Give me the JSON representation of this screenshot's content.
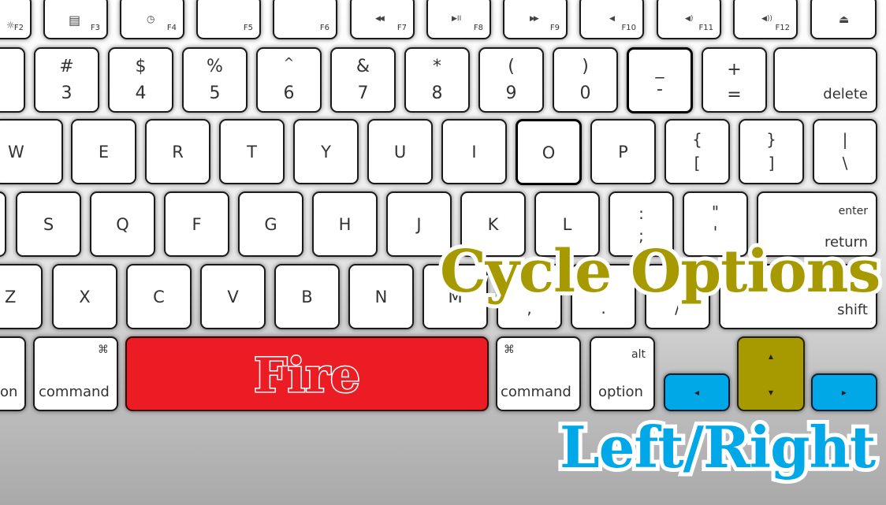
{
  "function_row": [
    {
      "icon": "☼",
      "label": "F2"
    },
    {
      "icon": "▤",
      "label": "F3"
    },
    {
      "icon": "◷",
      "label": "F4"
    },
    {
      "icon": "",
      "label": "F5"
    },
    {
      "icon": "",
      "label": "F6"
    },
    {
      "icon": "◀◀",
      "label": "F7"
    },
    {
      "icon": "▶II",
      "label": "F8"
    },
    {
      "icon": "▶▶",
      "label": "F9"
    },
    {
      "icon": "◀",
      "label": "F10"
    },
    {
      "icon": "◀)",
      "label": "F11"
    },
    {
      "icon": "◀))",
      "label": "F12"
    },
    {
      "icon": "⏏",
      "label": ""
    }
  ],
  "number_row": [
    {
      "top": "#",
      "bottom": "3"
    },
    {
      "top": "$",
      "bottom": "4"
    },
    {
      "top": "%",
      "bottom": "5"
    },
    {
      "top": "^",
      "bottom": "6"
    },
    {
      "top": "&",
      "bottom": "7"
    },
    {
      "top": "*",
      "bottom": "8"
    },
    {
      "top": "(",
      "bottom": "9"
    },
    {
      "top": ")",
      "bottom": "0"
    },
    {
      "top": "_",
      "bottom": "-"
    },
    {
      "top": "+",
      "bottom": "="
    },
    {
      "label": "delete"
    }
  ],
  "top_row": [
    {
      "label": "W"
    },
    {
      "label": "E"
    },
    {
      "label": "R"
    },
    {
      "label": "T"
    },
    {
      "label": "Y"
    },
    {
      "label": "U"
    },
    {
      "label": "I"
    },
    {
      "label": "O"
    },
    {
      "label": "P"
    },
    {
      "top": "{",
      "bottom": "["
    },
    {
      "top": "}",
      "bottom": "]"
    },
    {
      "top": "|",
      "bottom": "\\"
    }
  ],
  "home_row": [
    {
      "label": "S"
    },
    {
      "label": "Q"
    },
    {
      "label": "F"
    },
    {
      "label": "G"
    },
    {
      "label": "H"
    },
    {
      "label": "J"
    },
    {
      "label": "K"
    },
    {
      "label": "L"
    },
    {
      "top": ":",
      "bottom": ";"
    },
    {
      "top": "\"",
      "bottom": "'"
    },
    {
      "top": "enter",
      "bottom": "return"
    }
  ],
  "bottom_row": [
    {
      "label": "Z"
    },
    {
      "label": "X"
    },
    {
      "label": "C"
    },
    {
      "label": "V"
    },
    {
      "label": "B"
    },
    {
      "label": "N"
    },
    {
      "label": "M"
    },
    {
      "label": ","
    },
    {
      "label": "."
    },
    {
      "label": "/"
    },
    {
      "label": "shift"
    }
  ],
  "modifier_row": {
    "left_partial": "on",
    "left_command": {
      "glyph": "⌘",
      "label": "command"
    },
    "space_label": "Fire",
    "right_command": {
      "glyph": "⌘",
      "label": "command"
    },
    "right_option": {
      "top": "alt",
      "label": "option"
    },
    "arrow_left": "◀",
    "arrow_up": "▲",
    "arrow_down": "▼",
    "arrow_right": "▶"
  },
  "overlay": {
    "cycle_options": "Cycle Options",
    "left_right": "Left/Right"
  },
  "colors": {
    "fire_red": "#ec1c24",
    "cycle_olive": "#a69a00",
    "left_right_blue": "#00a8e8"
  }
}
